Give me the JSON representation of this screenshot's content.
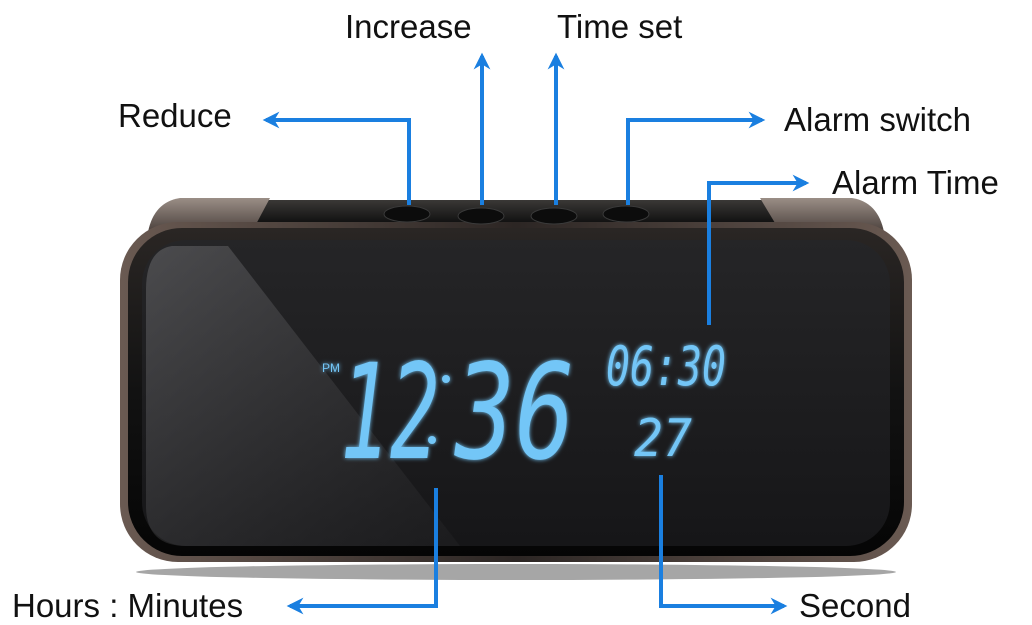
{
  "labels": {
    "increase": "Increase",
    "time_set": "Time set",
    "reduce": "Reduce",
    "alarm_switch": "Alarm switch",
    "alarm_time": "Alarm Time",
    "hours_minutes": "Hours : Minutes",
    "second": "Second"
  },
  "display": {
    "meridiem": "PM",
    "hours": "12",
    "minutes": "36",
    "alarm_time": "06:30",
    "seconds": "27"
  },
  "colors": {
    "arrow": "#1a7fe0",
    "lcd": "#73c6f7",
    "body": "#161616",
    "screen": "#1c1c1e"
  }
}
